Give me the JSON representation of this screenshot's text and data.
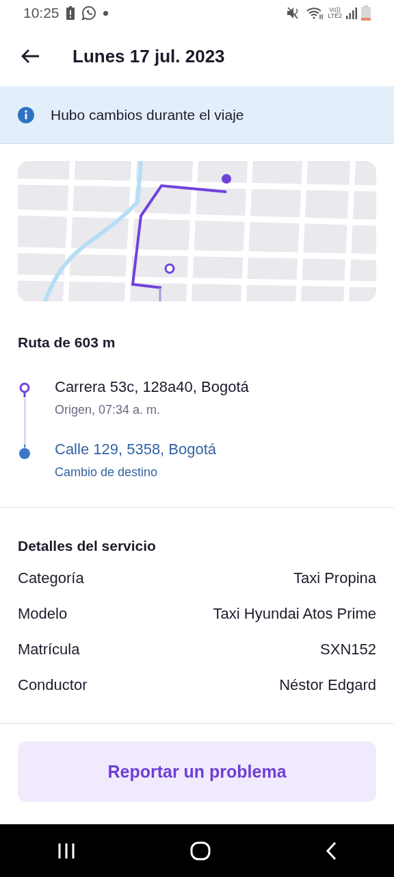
{
  "status_bar": {
    "time": "10:25",
    "volte": "Vo))",
    "network": "LTE2"
  },
  "header": {
    "title": "Lunes 17 jul. 2023"
  },
  "banner": {
    "text": "Hubo cambios durante el viaje"
  },
  "route": {
    "title": "Ruta de 603 m",
    "stops": [
      {
        "kind": "origin",
        "address": "Carrera 53c, 128a40, Bogotá",
        "detail": "Origen, 07:34 a. m."
      },
      {
        "kind": "destination",
        "address": "Calle 129, 5358, Bogotá",
        "detail": "Cambio de destino"
      }
    ]
  },
  "details": {
    "title": "Detalles del servicio",
    "rows": [
      {
        "label": "Categoría",
        "value": "Taxi Propina"
      },
      {
        "label": "Modelo",
        "value": "Taxi Hyundai Atos Prime"
      },
      {
        "label": "Matrícula",
        "value": "SXN152"
      },
      {
        "label": "Conductor",
        "value": "Néstor Edgard"
      }
    ]
  },
  "button": {
    "label": "Reportar un problema"
  }
}
